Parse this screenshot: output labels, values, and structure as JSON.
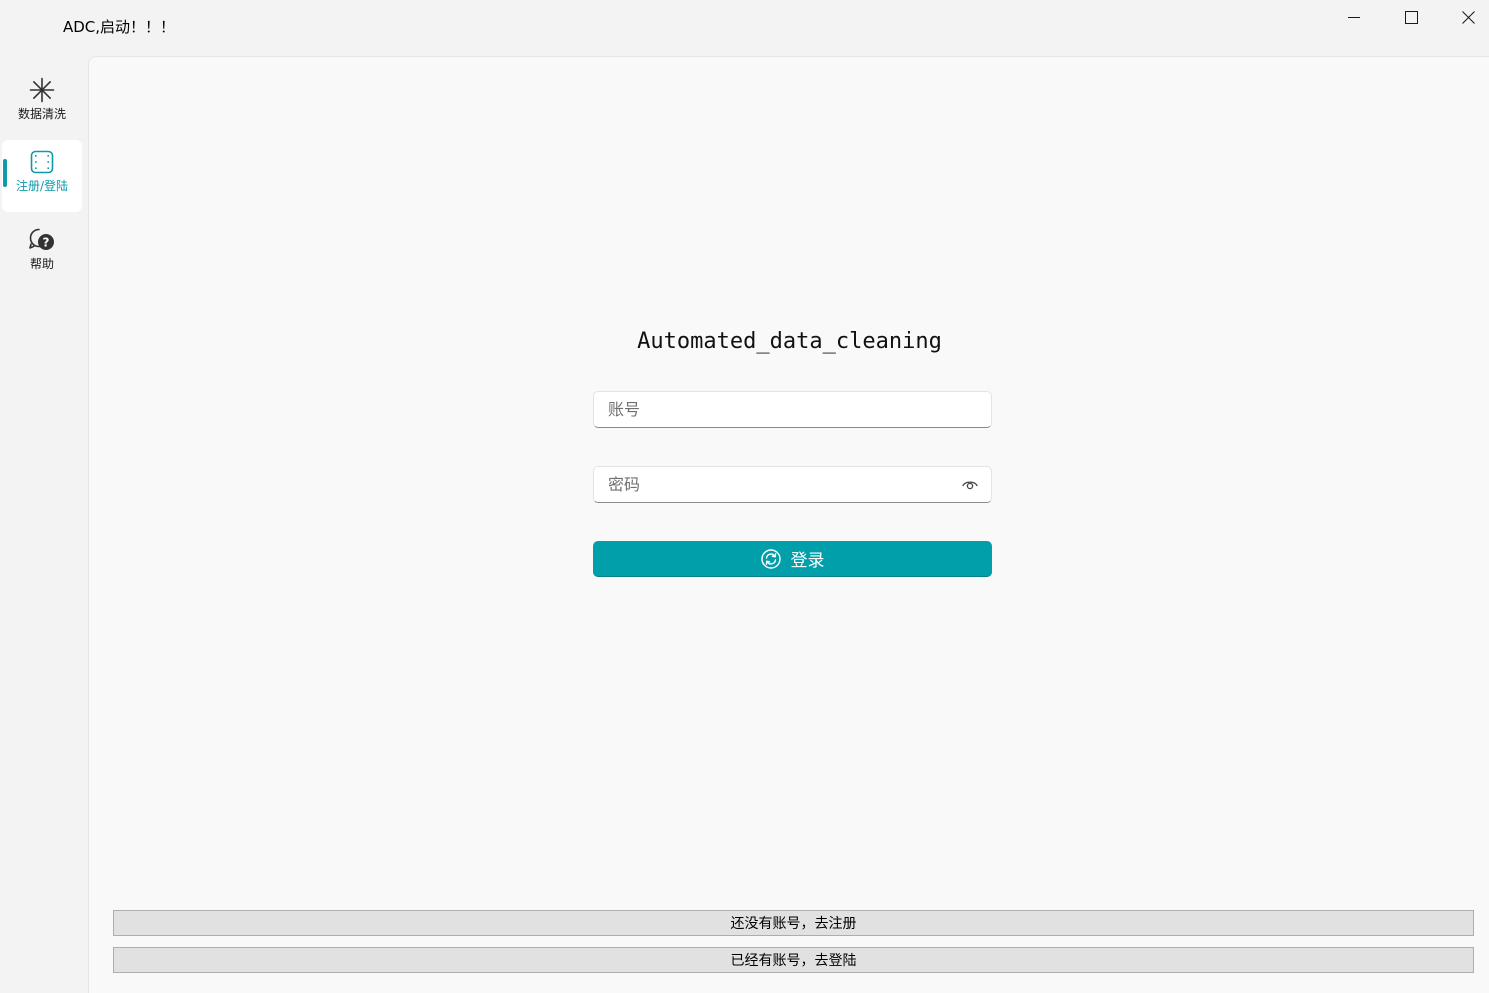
{
  "window": {
    "title": "ADC,启动！！！",
    "controls": [
      "minimize-icon",
      "maximize-icon",
      "close-icon"
    ]
  },
  "sidebar": {
    "items": [
      {
        "label": "数据清洗",
        "icon": "asterisk-icon",
        "active": false
      },
      {
        "label": "注册/登陆",
        "icon": "frame-icon",
        "active": true
      },
      {
        "label": "帮助",
        "icon": "help-chat-icon",
        "active": false
      }
    ]
  },
  "login": {
    "title": "Automated_data_cleaning",
    "account_placeholder": "账号",
    "password_placeholder": "密码",
    "password_toggle_icon": "eye-icon",
    "submit_label": "登录",
    "submit_icon": "sync-icon"
  },
  "footer": {
    "register_label": "还没有账号，去注册",
    "login_label": "已经有账号，去登陆"
  },
  "colors": {
    "accent": "#009faa",
    "sidebar_bg": "#f3f3f3",
    "content_bg": "#f9f9f9"
  }
}
